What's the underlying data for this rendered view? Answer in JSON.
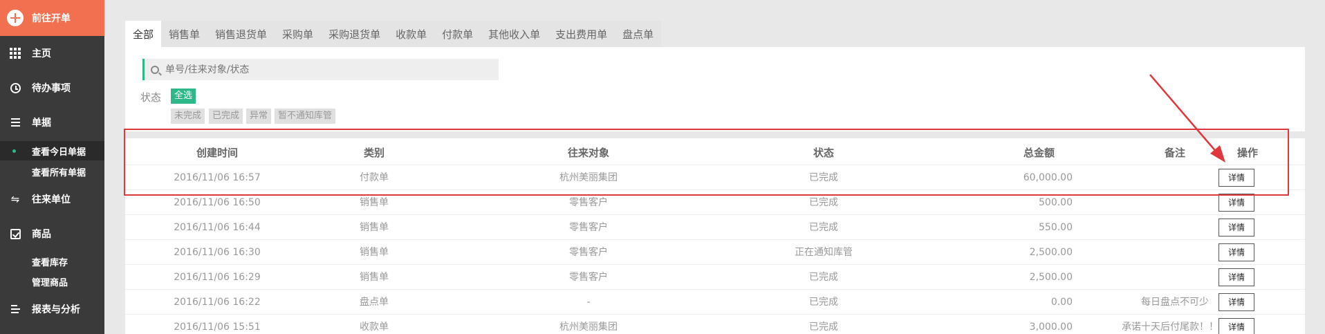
{
  "sidebar": {
    "new_order_label": "前往开单",
    "items": [
      {
        "label": "主页",
        "icon": "grid-icon"
      },
      {
        "label": "待办事项",
        "icon": "clock-icon"
      },
      {
        "label": "单据",
        "icon": "list-icon"
      },
      {
        "label": "往来单位",
        "icon": "transfer-icon"
      },
      {
        "label": "商品",
        "icon": "checkbox-icon"
      },
      {
        "label": "报表与分析",
        "icon": "report-icon"
      }
    ],
    "sub_documents": [
      "查看今日单据",
      "查看所有单据"
    ],
    "sub_goods": [
      "查看库存",
      "管理商品"
    ]
  },
  "tabs": [
    "全部",
    "销售单",
    "销售退货单",
    "采购单",
    "采购退货单",
    "收款单",
    "付款单",
    "其他收入单",
    "支出费用单",
    "盘点单"
  ],
  "search": {
    "placeholder": "单号/往来对象/状态"
  },
  "status_filter": {
    "label": "状态",
    "options": [
      "全选",
      "未完成",
      "已完成",
      "异常",
      "暂不通知库管"
    ]
  },
  "table": {
    "headers": {
      "time": "创建时间",
      "type": "类别",
      "party": "往来对象",
      "status": "状态",
      "total": "总金额",
      "note": "备注",
      "op": "操作"
    },
    "detail_label": "详情",
    "rows": [
      {
        "time": "2016/11/06 16:57",
        "type": "付款单",
        "party": "杭州美丽集团",
        "status": "已完成",
        "total": "60,000.00",
        "note": ""
      },
      {
        "time": "2016/11/06 16:50",
        "type": "销售单",
        "party": "零售客户",
        "status": "已完成",
        "total": "500.00",
        "note": ""
      },
      {
        "time": "2016/11/06 16:44",
        "type": "销售单",
        "party": "零售客户",
        "status": "已完成",
        "total": "550.00",
        "note": ""
      },
      {
        "time": "2016/11/06 16:30",
        "type": "销售单",
        "party": "零售客户",
        "status": "正在通知库管",
        "total": "2,500.00",
        "note": ""
      },
      {
        "time": "2016/11/06 16:29",
        "type": "销售单",
        "party": "零售客户",
        "status": "已完成",
        "total": "2,500.00",
        "note": ""
      },
      {
        "time": "2016/11/06 16:22",
        "type": "盘点单",
        "party": "-",
        "status": "已完成",
        "total": "0.00",
        "note": "每日盘点不可少"
      },
      {
        "time": "2016/11/06 15:51",
        "type": "收款单",
        "party": "杭州美丽集团",
        "status": "已完成",
        "total": "3,000.00",
        "note": "承诺十天后付尾款！！！"
      }
    ]
  },
  "colors": {
    "accent": "#2eb88a",
    "brand": "#f0704f",
    "annotation": "#e0373c"
  }
}
